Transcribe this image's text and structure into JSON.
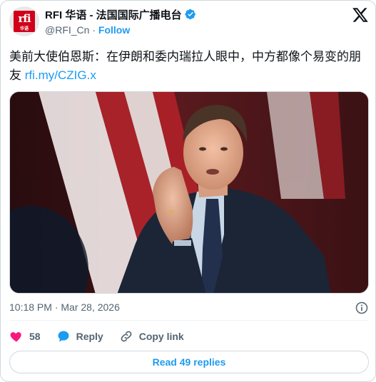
{
  "account": {
    "logo_text": "rfi",
    "logo_sub": "华语",
    "display_name": "RFI 华语 - 法国国际广播电台",
    "handle": "@RFI_Cn",
    "separator": "·",
    "follow_label": "Follow"
  },
  "tweet": {
    "text": "美前大使伯恩斯：在伊朗和委内瑞拉人眼中，中方都像个易变的朋友",
    "link": "rfi.my/CZIG.x"
  },
  "meta": {
    "timestamp": "10:18 PM · Mar 28, 2026"
  },
  "actions": {
    "like_count": "58",
    "reply_label": "Reply",
    "copy_link_label": "Copy link"
  },
  "footer": {
    "read_replies_label": "Read 49 replies"
  },
  "colors": {
    "accent": "#1d9bf0",
    "like": "#f91880",
    "text_primary": "#0f1419",
    "text_secondary": "#536471",
    "brand_red": "#d0021b"
  },
  "icons": [
    "verified-badge-icon",
    "x-logo-icon",
    "info-icon",
    "heart-icon",
    "reply-bubble-icon",
    "link-icon"
  ]
}
